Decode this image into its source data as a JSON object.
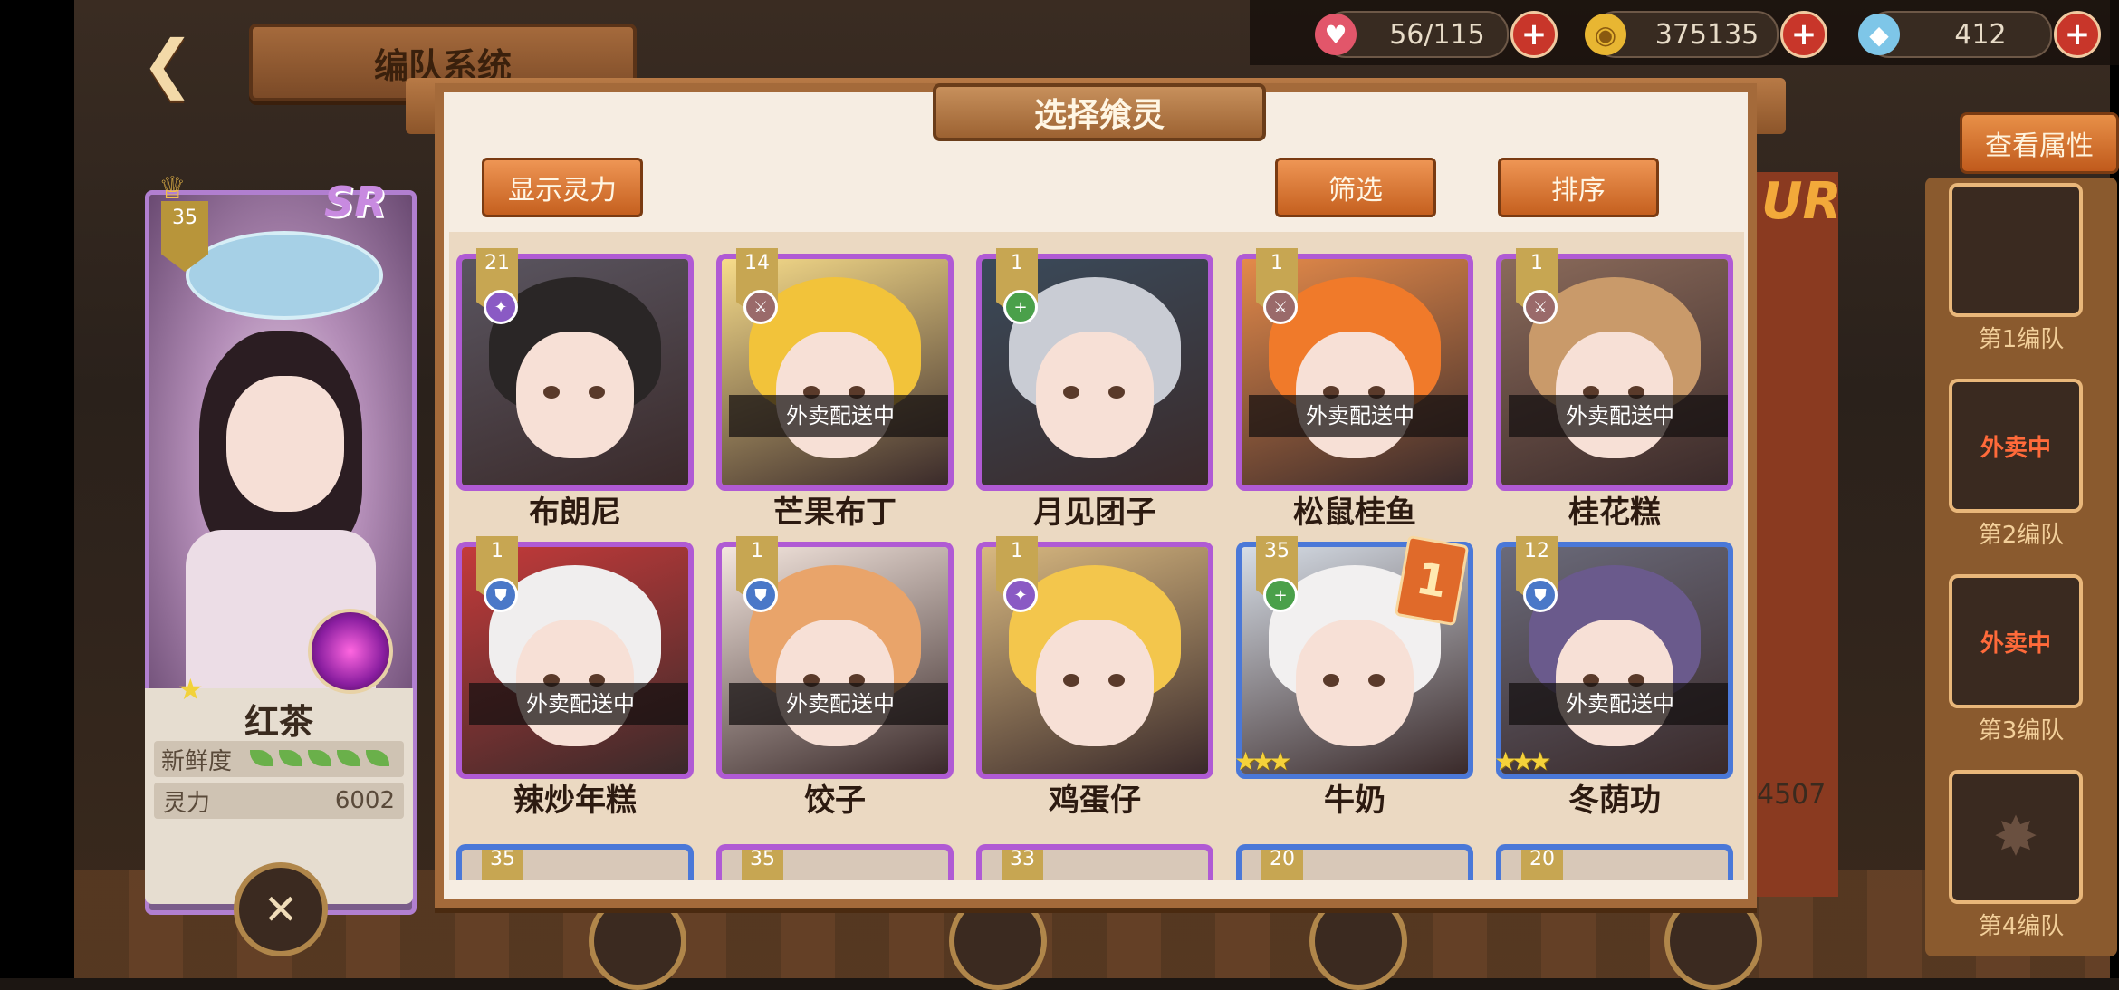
{
  "header": {
    "title": "编队系统"
  },
  "resources": [
    {
      "icon": "heart-icon",
      "value": "56/115"
    },
    {
      "icon": "coin-icon",
      "value": "375135"
    },
    {
      "icon": "crystal-icon",
      "value": "412"
    }
  ],
  "lead": {
    "level": "35",
    "rarity": "SR",
    "name": "红茶",
    "freshness_label": "新鲜度",
    "power_label": "灵力",
    "power_value": "6002"
  },
  "peek": {
    "rarity": "UR",
    "value": "4507"
  },
  "sidebar": {
    "attr_button": "查看属性",
    "teams": [
      {
        "label": "第1编队",
        "status": ""
      },
      {
        "label": "第2编队",
        "status": "外卖中"
      },
      {
        "label": "第3编队",
        "status": "外卖中"
      },
      {
        "label": "第4编队",
        "status": ""
      }
    ]
  },
  "modal": {
    "title": "选择飨灵",
    "show_power_button": "显示灵力",
    "filter_button": "筛选",
    "sort_button": "排序",
    "delivering_text": "外卖配送中",
    "characters": [
      {
        "name": "布朗尼",
        "level": "21",
        "frame": "purple",
        "delivering": false
      },
      {
        "name": "芒果布丁",
        "level": "14",
        "frame": "purple",
        "delivering": true
      },
      {
        "name": "月见团子",
        "level": "1",
        "frame": "purple",
        "delivering": false
      },
      {
        "name": "松鼠桂鱼",
        "level": "1",
        "frame": "purple",
        "delivering": true
      },
      {
        "name": "桂花糕",
        "level": "1",
        "frame": "purple",
        "delivering": true
      },
      {
        "name": "辣炒年糕",
        "level": "1",
        "frame": "purple",
        "delivering": true
      },
      {
        "name": "饺子",
        "level": "1",
        "frame": "purple",
        "delivering": true
      },
      {
        "name": "鸡蛋仔",
        "level": "1",
        "frame": "purple",
        "delivering": false
      },
      {
        "name": "牛奶",
        "level": "35",
        "frame": "blue",
        "delivering": false,
        "stars": "★★★",
        "card": "1"
      },
      {
        "name": "冬荫功",
        "level": "12",
        "frame": "blue",
        "delivering": true,
        "stars": "★★★"
      }
    ],
    "partial_levels": [
      "35",
      "35",
      "33",
      "20",
      "20"
    ]
  }
}
